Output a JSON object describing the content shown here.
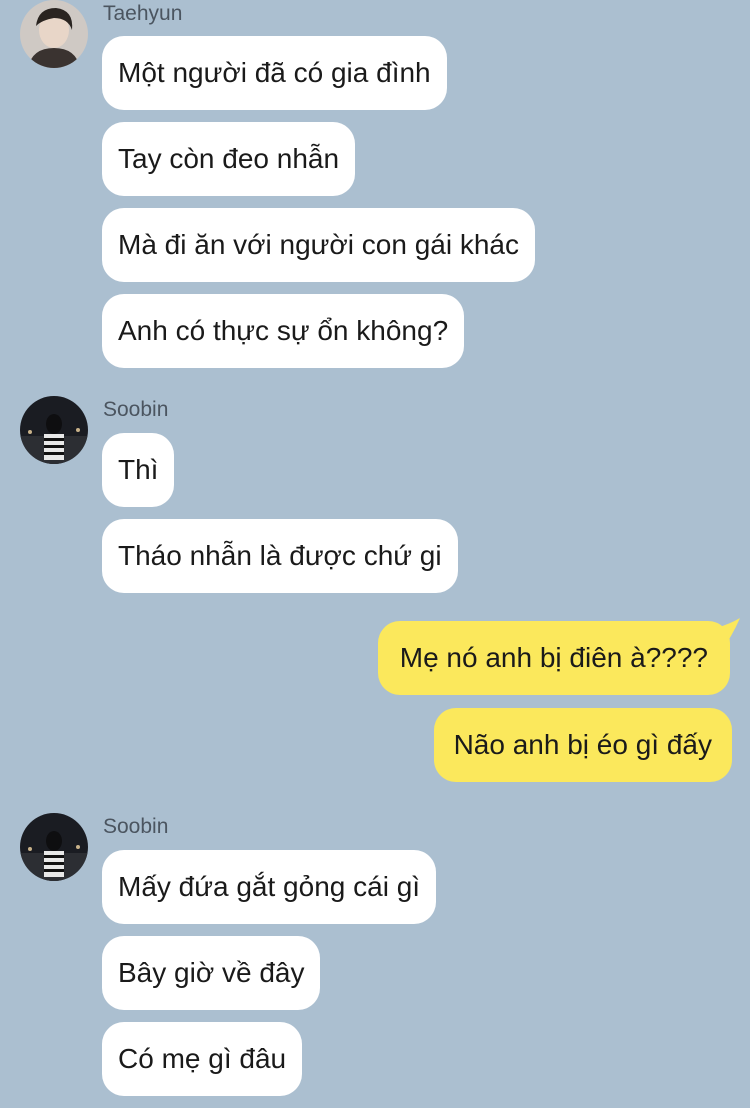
{
  "groups": [
    {
      "sender": "Taehyun",
      "avatar_icon": "taehyun-avatar-icon",
      "messages": [
        "Một người đã có gia đình",
        "Tay còn đeo nhẫn",
        "Mà đi ăn với người con gái khác",
        "Anh có thực sự ổn không?"
      ]
    },
    {
      "sender": "Soobin",
      "avatar_icon": "soobin-avatar-icon",
      "messages": [
        "Thì",
        "Tháo nhẫn là được chứ gi"
      ]
    },
    {
      "sender": "",
      "messages": [
        "Mẹ nó anh bị điên à????",
        "Não anh bị éo gì đấy"
      ]
    },
    {
      "sender": "Soobin",
      "avatar_icon": "soobin-avatar-icon",
      "messages": [
        "Mấy đứa gắt gỏng cái gì",
        "Bây giờ về đây",
        "Có mẹ gì đâu"
      ]
    }
  ],
  "colors": {
    "background": "#abbfd0",
    "incoming_bubble": "#ffffff",
    "outgoing_bubble": "#fbe85c"
  }
}
